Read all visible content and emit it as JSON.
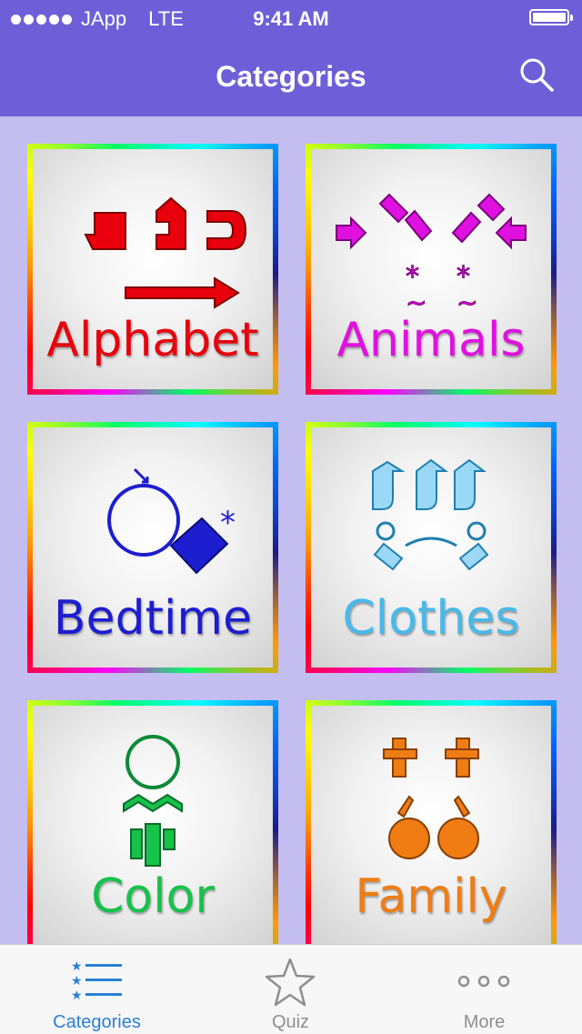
{
  "status": {
    "carrier": "JApp",
    "network": "LTE",
    "time": "9:41 AM",
    "battery_percent": 100
  },
  "nav": {
    "title": "Categories",
    "search_icon": "search-icon"
  },
  "colors": {
    "nav_background": "#6e5fd9",
    "page_background": "#c4bdf0",
    "tab_active": "#2a7fd6",
    "tab_inactive": "#8e8e93"
  },
  "categories": [
    {
      "label": "Alphabet",
      "color": "#e8000c"
    },
    {
      "label": "Animals",
      "color": "#e010e0"
    },
    {
      "label": "Bedtime",
      "color": "#1d1dd0"
    },
    {
      "label": "Clothes",
      "color": "#49b8ea"
    },
    {
      "label": "Color",
      "color": "#16c24a"
    },
    {
      "label": "Family",
      "color": "#ef7d14"
    }
  ],
  "tabs": [
    {
      "label": "Categories",
      "icon": "list-icon",
      "active": true
    },
    {
      "label": "Quiz",
      "icon": "star-icon",
      "active": false
    },
    {
      "label": "More",
      "icon": "more-icon",
      "active": false
    }
  ]
}
